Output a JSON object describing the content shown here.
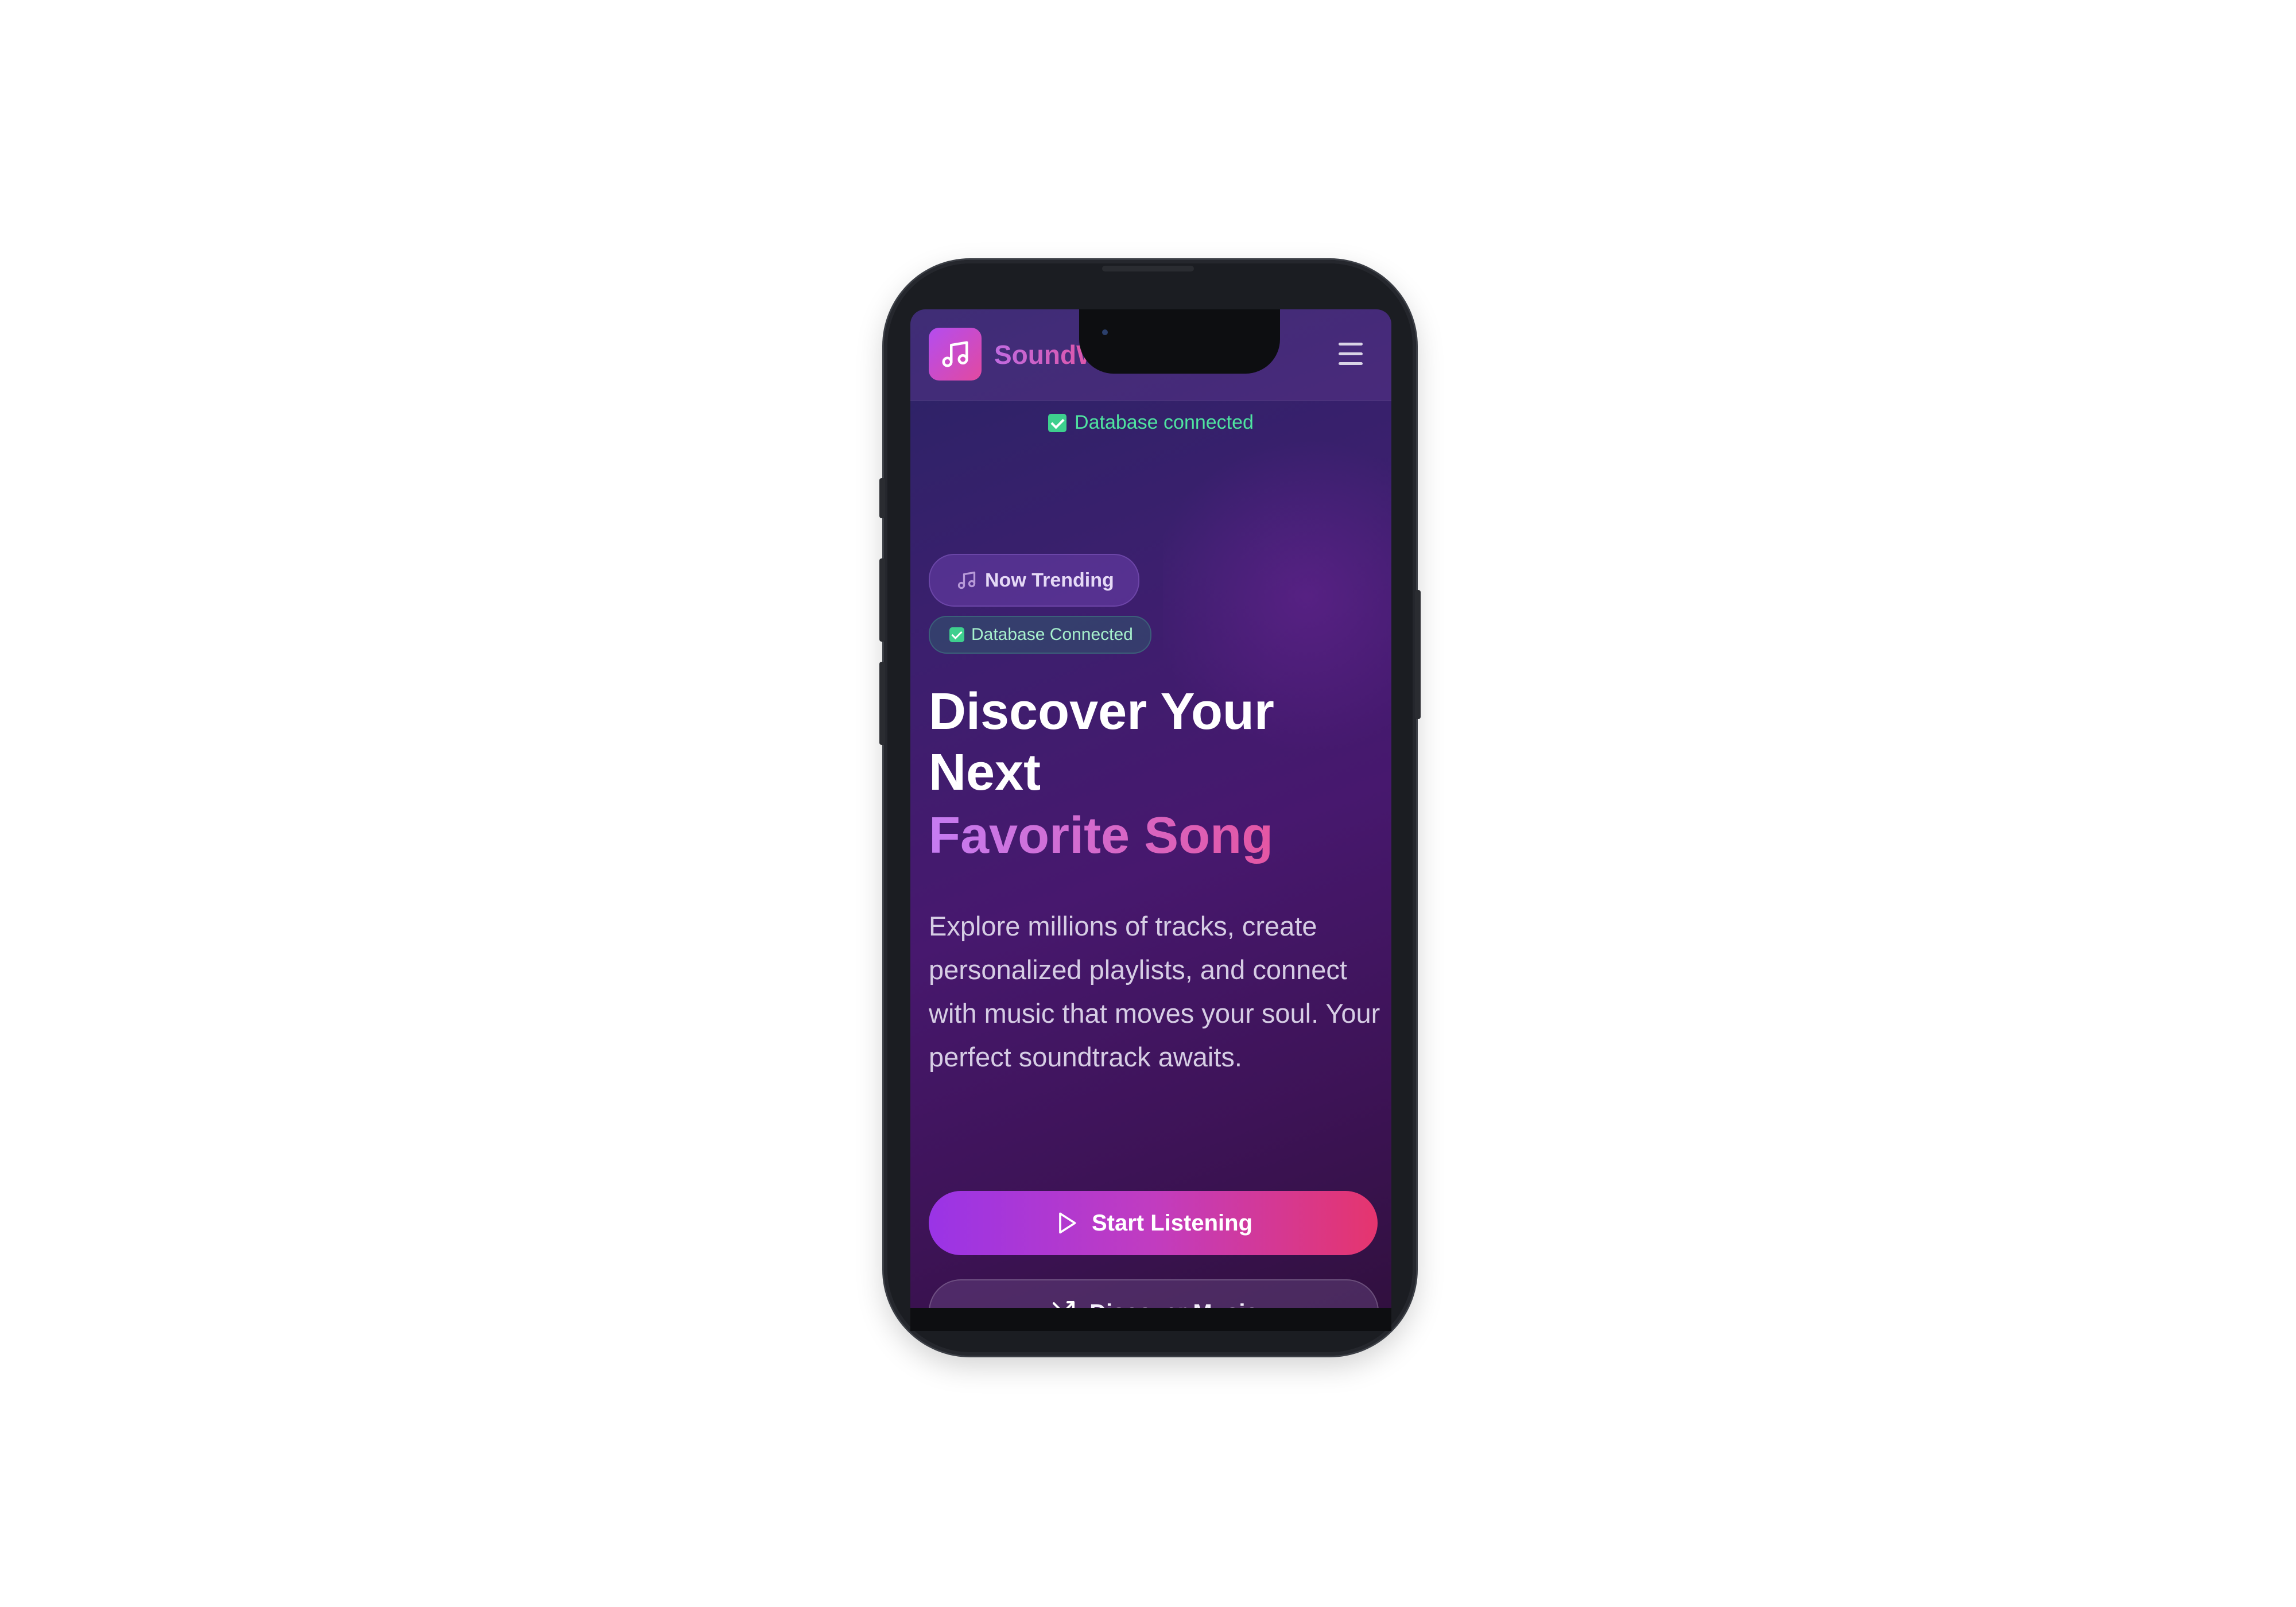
{
  "header": {
    "brand": "SoundWave"
  },
  "status": {
    "db_line": "Database connected"
  },
  "hero": {
    "trending_pill": "Now Trending",
    "db_pill": "Database Connected",
    "title_line1": "Discover Your",
    "title_line2": "Next",
    "title_accent": "Favorite Song",
    "lead": "Explore millions of tracks, create personalized playlists, and connect with music that moves your soul. Your perfect soundtrack awaits."
  },
  "actions": {
    "primary_label": "Start Listening",
    "secondary_label": "Discover Music"
  },
  "icons": {
    "logo": "music-note-icon",
    "menu": "hamburger-menu-icon",
    "trending": "music-note-icon",
    "check": "checkbox-check-icon",
    "play": "play-icon",
    "shuffle": "shuffle-icon"
  },
  "colors": {
    "accent_purple": "#9a34e6",
    "accent_pink": "#e5356e",
    "success_green": "#3ecf8e",
    "background_deep": "#3c1f6e"
  }
}
